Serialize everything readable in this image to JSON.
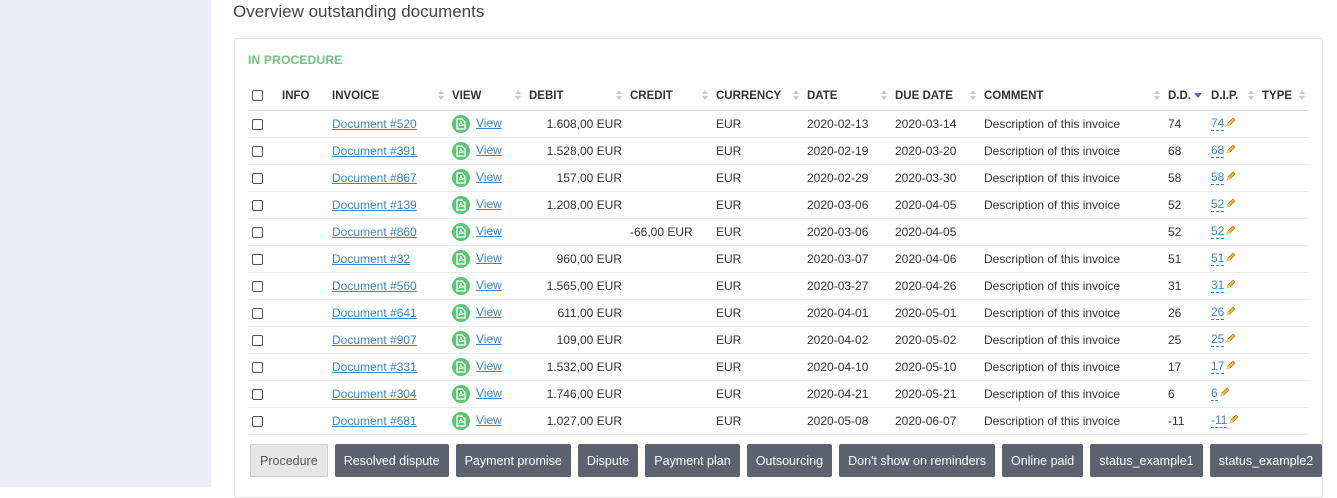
{
  "page": {
    "title": "Overview outstanding documents"
  },
  "section": {
    "label": "IN PROCEDURE"
  },
  "table": {
    "columns": [
      "INFO",
      "INVOICE",
      "VIEW",
      "DEBIT",
      "CREDIT",
      "CURRENCY",
      "DATE",
      "DUE DATE",
      "COMMENT",
      "D.D.",
      "D.I.P.",
      "TYPE"
    ],
    "rows": [
      {
        "invoice": "Document #520",
        "view": "View",
        "debit": "1.608,00 EUR",
        "credit": "",
        "currency": "EUR",
        "date": "2020-02-13",
        "due_date": "2020-03-14",
        "comment": "Description of this invoice",
        "dd": "74",
        "dip": "74"
      },
      {
        "invoice": "Document #391",
        "view": "View",
        "debit": "1.528,00 EUR",
        "credit": "",
        "currency": "EUR",
        "date": "2020-02-19",
        "due_date": "2020-03-20",
        "comment": "Description of this invoice",
        "dd": "68",
        "dip": "68"
      },
      {
        "invoice": "Document #867",
        "view": "View",
        "debit": "157,00 EUR",
        "credit": "",
        "currency": "EUR",
        "date": "2020-02-29",
        "due_date": "2020-03-30",
        "comment": "Description of this invoice",
        "dd": "58",
        "dip": "58"
      },
      {
        "invoice": "Document #139",
        "view": "View",
        "debit": "1.208,00 EUR",
        "credit": "",
        "currency": "EUR",
        "date": "2020-03-06",
        "due_date": "2020-04-05",
        "comment": "Description of this invoice",
        "dd": "52",
        "dip": "52"
      },
      {
        "invoice": "Document #860",
        "view": "View",
        "debit": "",
        "credit": "-66,00 EUR",
        "currency": "EUR",
        "date": "2020-03-06",
        "due_date": "2020-04-05",
        "comment": "",
        "dd": "52",
        "dip": "52"
      },
      {
        "invoice": "Document #32",
        "view": "View",
        "debit": "960,00 EUR",
        "credit": "",
        "currency": "EUR",
        "date": "2020-03-07",
        "due_date": "2020-04-06",
        "comment": "Description of this invoice",
        "dd": "51",
        "dip": "51"
      },
      {
        "invoice": "Document #560",
        "view": "View",
        "debit": "1.565,00 EUR",
        "credit": "",
        "currency": "EUR",
        "date": "2020-03-27",
        "due_date": "2020-04-26",
        "comment": "Description of this invoice",
        "dd": "31",
        "dip": "31"
      },
      {
        "invoice": "Document #641",
        "view": "View",
        "debit": "611,00 EUR",
        "credit": "",
        "currency": "EUR",
        "date": "2020-04-01",
        "due_date": "2020-05-01",
        "comment": "Description of this invoice",
        "dd": "26",
        "dip": "26"
      },
      {
        "invoice": "Document #907",
        "view": "View",
        "debit": "109,00 EUR",
        "credit": "",
        "currency": "EUR",
        "date": "2020-04-02",
        "due_date": "2020-05-02",
        "comment": "Description of this invoice",
        "dd": "25",
        "dip": "25"
      },
      {
        "invoice": "Document #331",
        "view": "View",
        "debit": "1.532,00 EUR",
        "credit": "",
        "currency": "EUR",
        "date": "2020-04-10",
        "due_date": "2020-05-10",
        "comment": "Description of this invoice",
        "dd": "17",
        "dip": "17"
      },
      {
        "invoice": "Document #304",
        "view": "View",
        "debit": "1.746,00 EUR",
        "credit": "",
        "currency": "EUR",
        "date": "2020-04-21",
        "due_date": "2020-05-21",
        "comment": "Description of this invoice",
        "dd": "6",
        "dip": "6"
      },
      {
        "invoice": "Document #681",
        "view": "View",
        "debit": "1.027,00 EUR",
        "credit": "",
        "currency": "EUR",
        "date": "2020-05-08",
        "due_date": "2020-06-07",
        "comment": "Description of this invoice",
        "dd": "-11",
        "dip": "-11"
      }
    ]
  },
  "status_buttons": [
    {
      "label": "Procedure",
      "active": true
    },
    {
      "label": "Resolved dispute",
      "active": false
    },
    {
      "label": "Payment promise",
      "active": false
    },
    {
      "label": "Dispute",
      "active": false
    },
    {
      "label": "Payment plan",
      "active": false
    },
    {
      "label": "Outsourcing",
      "active": false
    },
    {
      "label": "Don't show on reminders",
      "active": false
    },
    {
      "label": "Online paid",
      "active": false
    },
    {
      "label": "status_example1",
      "active": false
    },
    {
      "label": "status_example2",
      "active": false
    }
  ],
  "colors": {
    "section_label": "#6cc77c",
    "link": "#3b86c9",
    "negative": "#e05a4b",
    "button_bg": "#5d6271",
    "pdf_icon": "#5cc476"
  },
  "icons": {
    "view": "pdf-icon",
    "edit_dip": "pencil-icon",
    "sort": "sort-arrows-icon",
    "sort_active": "sort-desc-icon"
  }
}
